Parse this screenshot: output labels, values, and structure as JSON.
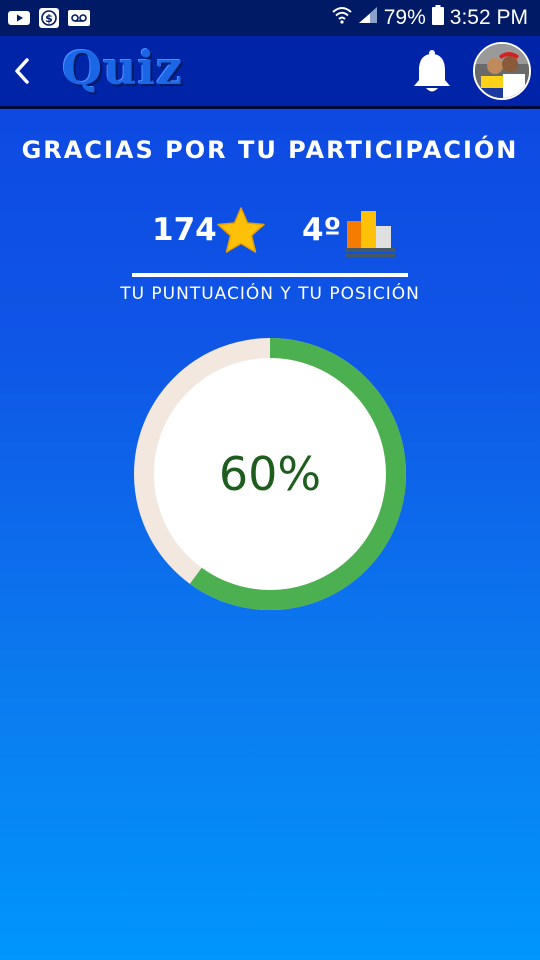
{
  "status_bar": {
    "icons_left": [
      "youtube-icon",
      "dollar-app-icon",
      "voicemail-icon"
    ],
    "wifi_icon": "wifi-icon",
    "signal_icon": "signal-icon",
    "battery_percent": "79%",
    "battery_icon": "battery-icon",
    "time": "3:52 PM"
  },
  "app_bar": {
    "back_icon": "chevron-left-icon",
    "title": "Quiz",
    "bell_icon": "bell-icon",
    "avatar_icon": "avatar"
  },
  "results": {
    "thanks_text": "GRACIAS POR TU PARTICIPACIÓN",
    "score": "174",
    "score_icon": "star-icon",
    "position": "4º",
    "position_icon": "podium-icon",
    "caption": "TU PUNTUACIÓN Y TU POSICIÓN",
    "progress_label": "60%",
    "progress_fraction": 0.6
  },
  "colors": {
    "progress_fill": "#4caf50",
    "progress_track": "#f3e8e0",
    "progress_text": "#1f5d1f",
    "star": "#ffc107"
  }
}
